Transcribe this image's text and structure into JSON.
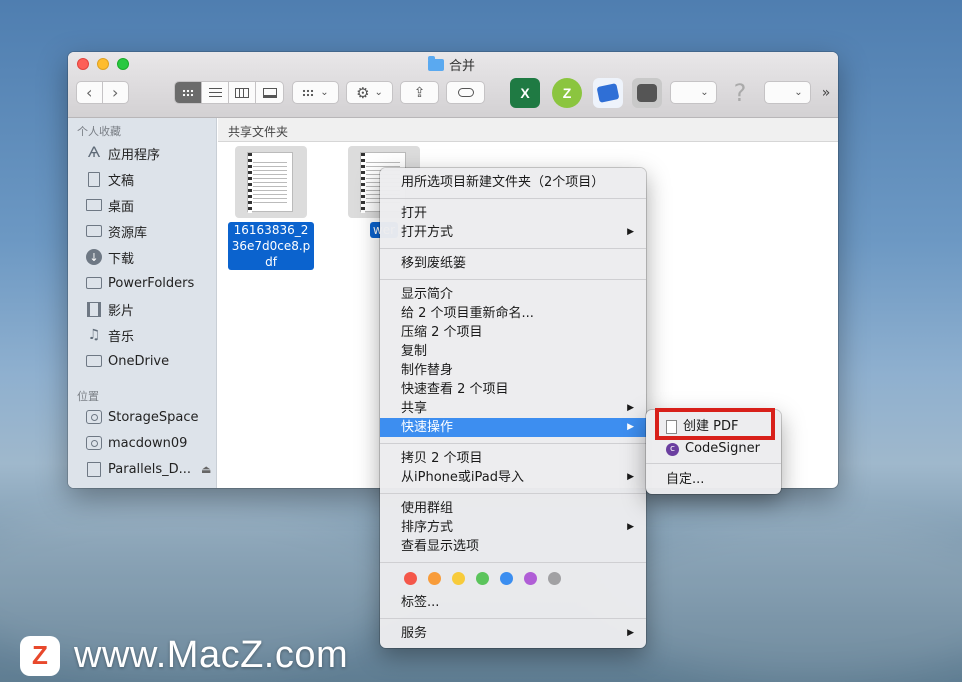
{
  "window": {
    "title": "合并"
  },
  "toolbar": {
    "gear": "⚙",
    "share": "⇪",
    "help": "?",
    "overflow": "»",
    "chevron": "⌄"
  },
  "sidebar": {
    "favorites_header": "个人收藏",
    "favorites": [
      {
        "label": "应用程序",
        "icon": "apps-icon"
      },
      {
        "label": "文稿",
        "icon": "document-icon"
      },
      {
        "label": "桌面",
        "icon": "desktop-icon"
      },
      {
        "label": "资源库",
        "icon": "folder-icon"
      },
      {
        "label": "下载",
        "icon": "download-icon"
      },
      {
        "label": "PowerFolders",
        "icon": "folder-icon"
      },
      {
        "label": "影片",
        "icon": "movie-icon"
      },
      {
        "label": "音乐",
        "icon": "music-icon"
      },
      {
        "label": "OneDrive",
        "icon": "folder-icon"
      }
    ],
    "locations_header": "位置",
    "locations": [
      {
        "label": "StorageSpace",
        "icon": "disk-icon"
      },
      {
        "label": "macdown09",
        "icon": "disk-icon"
      },
      {
        "label": "Parallels_D...",
        "icon": "disk-icon",
        "eject": "⏏"
      }
    ]
  },
  "content": {
    "path": "共享文件夹",
    "files": [
      {
        "name": "16163836_236e7d0ce8.pdf"
      },
      {
        "name": "wer"
      }
    ]
  },
  "context_menu": {
    "new_folder": "用所选项目新建文件夹（2个项目）",
    "open": "打开",
    "open_with": "打开方式",
    "trash": "移到废纸篓",
    "get_info": "显示简介",
    "rename": "给 2 个项目重新命名...",
    "compress": "压缩 2 个项目",
    "duplicate": "复制",
    "make_alias": "制作替身",
    "quick_look": "快速查看 2 个项目",
    "share": "共享",
    "quick_actions": "快速操作",
    "copy": "拷贝 2 个项目",
    "import": "从iPhone或iPad导入",
    "use_groups": "使用群组",
    "sort_by": "排序方式",
    "view_options": "查看显示选项",
    "tags": "标签...",
    "services": "服务",
    "submenu_arrow": "▶",
    "tag_colors": [
      "#f4574a",
      "#f89c3a",
      "#f7cb3a",
      "#5bc45b",
      "#3b8ef0",
      "#b05ed6",
      "#a1a1a3"
    ]
  },
  "submenu": {
    "create_pdf": "创建 PDF",
    "codesigner": "CodeSigner",
    "customize": "自定..."
  },
  "watermark": {
    "logo": "Z",
    "text": "www.MacZ.com"
  },
  "colors": {
    "highlight": "#3d8ef0",
    "selection": "#0b63ce",
    "annotation": "#d8201a"
  }
}
